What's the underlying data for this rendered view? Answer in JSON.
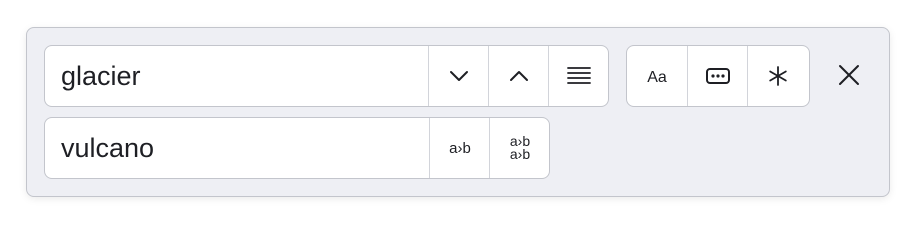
{
  "find": {
    "value": "glacier",
    "next_icon": "chevron-down-icon",
    "prev_icon": "chevron-up-icon",
    "select_all_icon": "lines-icon"
  },
  "replace": {
    "value": "vulcano",
    "replace_one_icon": "replace-icon",
    "replace_all_icon": "replace-all-icon"
  },
  "options": {
    "match_case_icon": "case-sensitive-icon",
    "whole_word_icon": "whole-word-icon",
    "regex_icon": "regex-icon"
  },
  "close_icon": "close-icon",
  "glyphs": {
    "match_case": "Aa",
    "replace_one": "a›b",
    "replace_all_top": "a›b",
    "replace_all_bottom": "a›b"
  },
  "colors": {
    "panel_bg": "#eeeff4",
    "border": "#c3c5cc",
    "text": "#1e1f24"
  }
}
